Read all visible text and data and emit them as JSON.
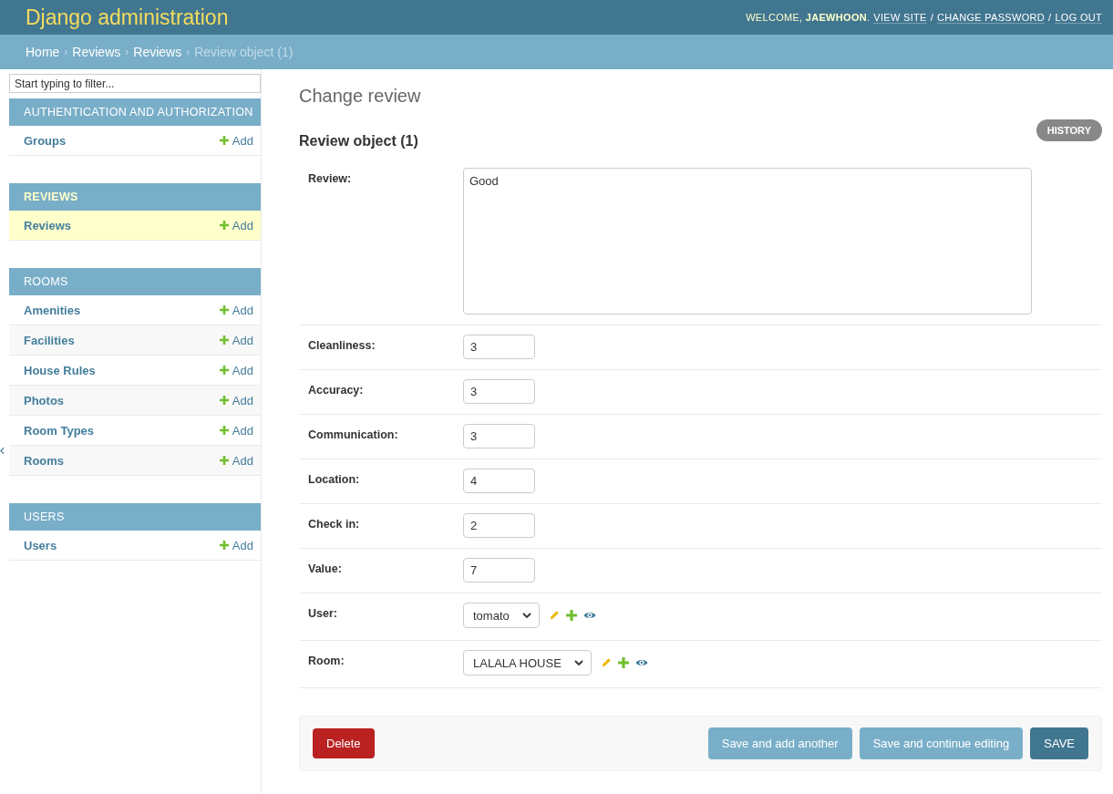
{
  "header": {
    "title": "Django administration",
    "welcome": "WELCOME, **JAEWHOON**.",
    "links": [
      "VIEW SITE",
      "CHANGE PASSWORD",
      "LOG OUT"
    ],
    "link_separator": "/"
  },
  "breadcrumbs": {
    "separator": "›",
    "items": [
      {
        "label": "Home",
        "current": false
      },
      {
        "label": "Reviews",
        "current": false
      },
      {
        "label": "Reviews",
        "current": false
      },
      {
        "label": "Review object (1)",
        "current": true
      }
    ]
  },
  "sidebar": {
    "filter_placeholder": "Start typing to filter...",
    "sections": [
      {
        "title": "AUTHENTICATION AND AUTHORIZATION",
        "selected": false,
        "models": [
          {
            "name": "Groups",
            "add": "Add",
            "selected": false
          }
        ]
      },
      {
        "title": "REVIEWS",
        "selected": true,
        "models": [
          {
            "name": "Reviews",
            "add": "Add",
            "selected": true
          }
        ]
      },
      {
        "title": "ROOMS",
        "selected": false,
        "models": [
          {
            "name": "Amenities",
            "add": "Add",
            "selected": false
          },
          {
            "name": "Facilities",
            "add": "Add",
            "selected": false
          },
          {
            "name": "House Rules",
            "add": "Add",
            "selected": false
          },
          {
            "name": "Photos",
            "add": "Add",
            "selected": false
          },
          {
            "name": "Room Types",
            "add": "Add",
            "selected": false
          },
          {
            "name": "Rooms",
            "add": "Add",
            "selected": false
          }
        ]
      },
      {
        "title": "USERS",
        "selected": false,
        "models": [
          {
            "name": "Users",
            "add": "Add",
            "selected": false
          }
        ]
      }
    ]
  },
  "content": {
    "title": "Change review",
    "object_title": "Review object (1)",
    "history": "HISTORY",
    "fields": [
      {
        "label": "Review:",
        "kind": "textarea",
        "value": "Good"
      },
      {
        "label": "Cleanliness:",
        "kind": "number",
        "value": "3"
      },
      {
        "label": "Accuracy:",
        "kind": "number",
        "value": "3"
      },
      {
        "label": "Communication:",
        "kind": "number",
        "value": "3"
      },
      {
        "label": "Location:",
        "kind": "number",
        "value": "4"
      },
      {
        "label": "Check in:",
        "kind": "number",
        "value": "2"
      },
      {
        "label": "Value:",
        "kind": "number",
        "value": "7"
      },
      {
        "label": "User:",
        "kind": "select",
        "value": "tomato"
      },
      {
        "label": "Room:",
        "kind": "select",
        "value": "LALALA HOUSE"
      }
    ],
    "delete": "Delete",
    "buttons": [
      {
        "label": "Save and add another",
        "primary": false
      },
      {
        "label": "Save and continue editing",
        "primary": false
      },
      {
        "label": "SAVE",
        "primary": true
      }
    ]
  }
}
